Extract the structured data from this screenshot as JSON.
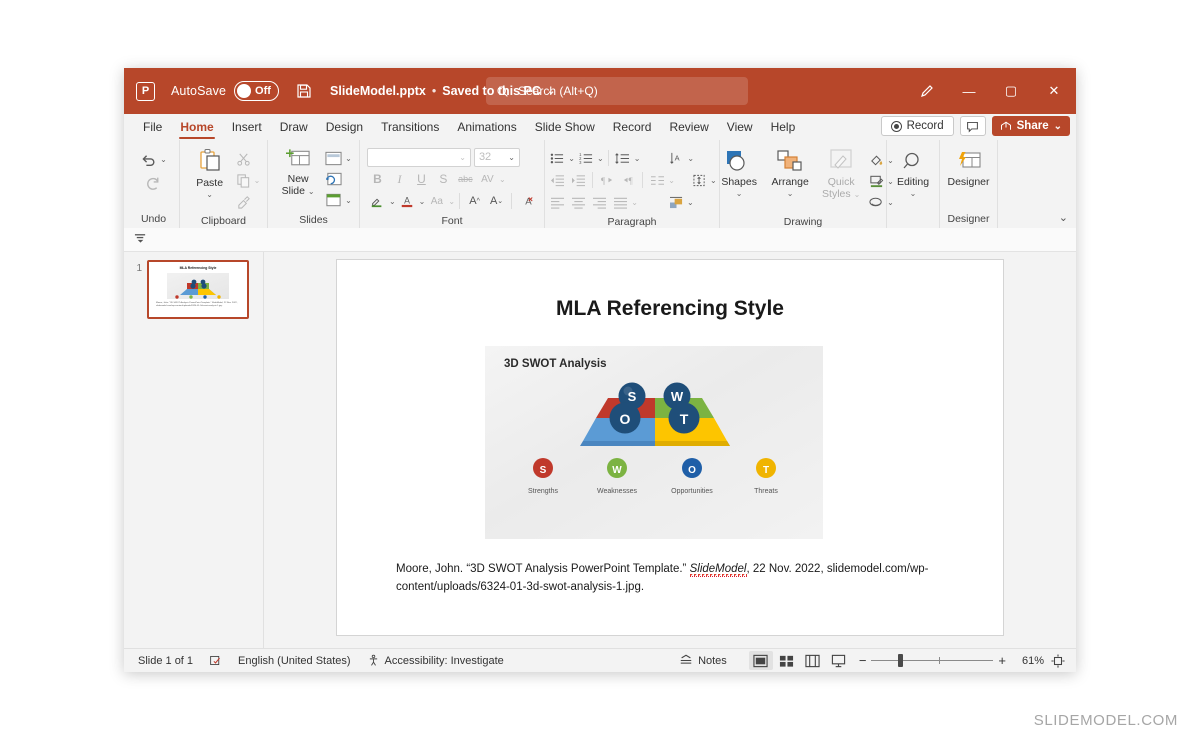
{
  "titlebar": {
    "app_icon": "powerpoint-logo-icon",
    "autosave_label": "AutoSave",
    "autosave_state": "Off",
    "save_icon": "save-icon",
    "document_name": "SlideModel.pptx",
    "separator": "•",
    "save_location": "Saved to this PC",
    "title_caret": "⌄",
    "search_icon": "search-icon",
    "search_placeholder": "Search (Alt+Q)",
    "pen_icon": "pen-icon",
    "minimize": "—",
    "maximize": "▢",
    "close": "✕",
    "bg_color": "#b7472a"
  },
  "ribbon_tabs": [
    {
      "label": "File",
      "active": false
    },
    {
      "label": "Home",
      "active": true
    },
    {
      "label": "Insert",
      "active": false
    },
    {
      "label": "Draw",
      "active": false
    },
    {
      "label": "Design",
      "active": false
    },
    {
      "label": "Transitions",
      "active": false
    },
    {
      "label": "Animations",
      "active": false
    },
    {
      "label": "Slide Show",
      "active": false
    },
    {
      "label": "Record",
      "active": false
    },
    {
      "label": "Review",
      "active": false
    },
    {
      "label": "View",
      "active": false
    },
    {
      "label": "Help",
      "active": false
    }
  ],
  "tab_right": {
    "record_label": "Record",
    "comments_icon": "comment-icon",
    "share_label": "Share",
    "share_caret": "⌄"
  },
  "ribbon_groups": {
    "undo": {
      "label": "Undo",
      "undo_icon": "undo-icon",
      "redo_icon": "redo-icon",
      "caret": "⌄"
    },
    "clipboard": {
      "label": "Clipboard",
      "paste_label": "Paste",
      "paste_caret": "⌄",
      "cut_icon": "scissors-icon",
      "copy_icon": "copy-icon",
      "format_painter_icon": "format-painter-icon",
      "launcher": "⌐"
    },
    "slides": {
      "label": "Slides",
      "new_slide_label": "New\nSlide",
      "new_slide_line1": "New",
      "new_slide_line2": "Slide",
      "layout_icon": "slide-layout-icon",
      "reset_icon": "reset-slide-icon",
      "section_icon": "section-icon"
    },
    "font": {
      "label": "Font",
      "font_name_value": "",
      "font_size_value": "32",
      "bold": "B",
      "italic": "I",
      "underline": "U",
      "shadow": "S",
      "strikethrough": "abc",
      "char_spacing": "AV",
      "text_highlight_icon": "text-highlight-icon",
      "font_color_icon": "font-color-icon",
      "change_case": "Aa",
      "grow_font": "A",
      "shrink_font": "A",
      "clear_formatting_icon": "clear-formatting-icon",
      "launcher": "⌐"
    },
    "paragraph": {
      "label": "Paragraph",
      "bullets_icon": "bullets-icon",
      "numbering_icon": "numbering-icon",
      "line_spacing_icon": "line-spacing-icon",
      "text_direction_icon": "text-direction-icon",
      "decrease_indent_icon": "decrease-indent-icon",
      "increase_indent_icon": "increase-indent-icon",
      "ltr_icon": "left-to-right-icon",
      "rtl_icon": "right-to-left-icon",
      "columns_icon": "columns-icon",
      "align_text_icon": "align-text-icon",
      "align_left_icon": "align-left-icon",
      "align_center_icon": "align-center-icon",
      "align_right_icon": "align-right-icon",
      "justify_icon": "justify-icon",
      "smartart_icon": "convert-to-smartart-icon",
      "launcher": "⌐"
    },
    "drawing": {
      "label": "Drawing",
      "shapes_label": "Shapes",
      "arrange_label": "Arrange",
      "quick_styles_line1": "Quick",
      "quick_styles_line2": "Styles",
      "shape_fill_icon": "shape-fill-icon",
      "shape_outline_icon": "shape-outline-icon",
      "shape_effects_icon": "shape-effects-icon",
      "caret": "⌄",
      "launcher": "⌐"
    },
    "editing": {
      "label": "",
      "editing_label": "Editing",
      "caret": "⌄",
      "icon": "magnifier-icon"
    },
    "designer": {
      "label": "Designer",
      "designer_label": "Designer",
      "icon": "designer-icon"
    },
    "collapse_caret": "⌄"
  },
  "qat_strip": {
    "icon": "quick-access-dropdown-icon"
  },
  "thumbnail_pane": {
    "slides": [
      {
        "number": "1",
        "title": "MLA Referencing Style",
        "citation": "Moore, John. “3D SWOT Analysis PowerPoint Template.” SlideModel, 22 Nov. 2022, slidemodel.com/wp-content/uploads/6324-01-3d-swot-analysis-1.jpg.",
        "selected": true
      }
    ]
  },
  "slide": {
    "title": "MLA Referencing Style",
    "image": {
      "heading": "3D SWOT Analysis",
      "platform_colors": {
        "strengths_red": "#c0392b",
        "weaknesses_green": "#7cb342",
        "opportunities_blue": "#5b9bd5",
        "threats_yellow": "#fdc500"
      },
      "top_balls": [
        {
          "letter": "S",
          "color": "#1f4e79"
        },
        {
          "letter": "W",
          "color": "#1f4e79"
        },
        {
          "letter": "O",
          "color": "#1f4e79"
        },
        {
          "letter": "T",
          "color": "#1f4e79"
        }
      ],
      "legend": [
        {
          "letter": "S",
          "label": "Strengths",
          "color": "#c0392b"
        },
        {
          "letter": "W",
          "label": "Weaknesses",
          "color": "#7cb342"
        },
        {
          "letter": "O",
          "label": "Opportunities",
          "color": "#1f5fa8"
        },
        {
          "letter": "T",
          "label": "Threats",
          "color": "#f0b400"
        }
      ]
    },
    "citation_line1_a": "Moore, John. “3D SWOT Analysis PowerPoint Template.” ",
    "citation_source": "SlideModel",
    "citation_line1_b": ", 22 Nov. 2022,",
    "citation_line2": "slidemodel.com/wp-content/uploads/6324-01-3d-swot-analysis-1.jpg."
  },
  "statusbar": {
    "slide_counter": "Slide 1 of 1",
    "spellcheck_icon": "spellcheck-icon",
    "language": "English (United States)",
    "accessibility_icon": "accessibility-icon",
    "accessibility_label": "Accessibility: Investigate",
    "notes_label": "Notes",
    "notes_icon": "notes-icon",
    "views": [
      {
        "name": "normal-view",
        "active": true
      },
      {
        "name": "slide-sorter-view",
        "active": false
      },
      {
        "name": "reading-view",
        "active": false
      },
      {
        "name": "slideshow-view",
        "active": false
      }
    ],
    "zoom_out": "−",
    "zoom_in": "+",
    "zoom_level": "61%",
    "fit_slide_icon": "fit-to-window-icon"
  },
  "watermark": "SLIDEMODEL.COM"
}
